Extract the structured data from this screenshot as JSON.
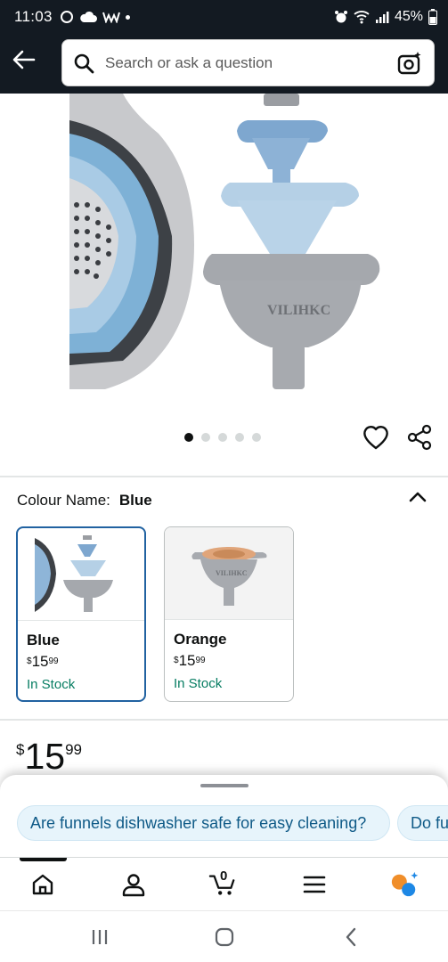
{
  "status_bar": {
    "time": "11:03",
    "battery": "45%"
  },
  "search": {
    "placeholder": "Search or ask a question"
  },
  "product_image": {
    "brand_text": "VILIHKC",
    "carousel": {
      "count": 5,
      "active_index": 0
    }
  },
  "colour": {
    "label": "Colour Name:",
    "selected": "Blue"
  },
  "swatches": [
    {
      "name": "Blue",
      "price_symbol": "$",
      "price_whole": "15",
      "price_fraction": "99",
      "stock": "In Stock",
      "accent": "#8eb5d8"
    },
    {
      "name": "Orange",
      "price_symbol": "$",
      "price_whole": "15",
      "price_fraction": "99",
      "stock": "In Stock",
      "accent": "#e0a57a"
    }
  ],
  "price": {
    "symbol": "$",
    "whole": "15",
    "fraction": "99"
  },
  "suggestions": [
    "Are funnels dishwasher safe for easy cleaning?",
    "Do fu"
  ],
  "bottom_nav": {
    "items": [
      "home-icon",
      "account-icon",
      "cart-icon",
      "menu-icon",
      "rufus-icon"
    ],
    "cart_count": "0"
  },
  "colors": {
    "header_bg": "#131a22",
    "selected_border": "#2162a1",
    "stock_green": "#067d62",
    "chip_bg": "#e7f4fb",
    "chip_text": "#0f5a87"
  }
}
